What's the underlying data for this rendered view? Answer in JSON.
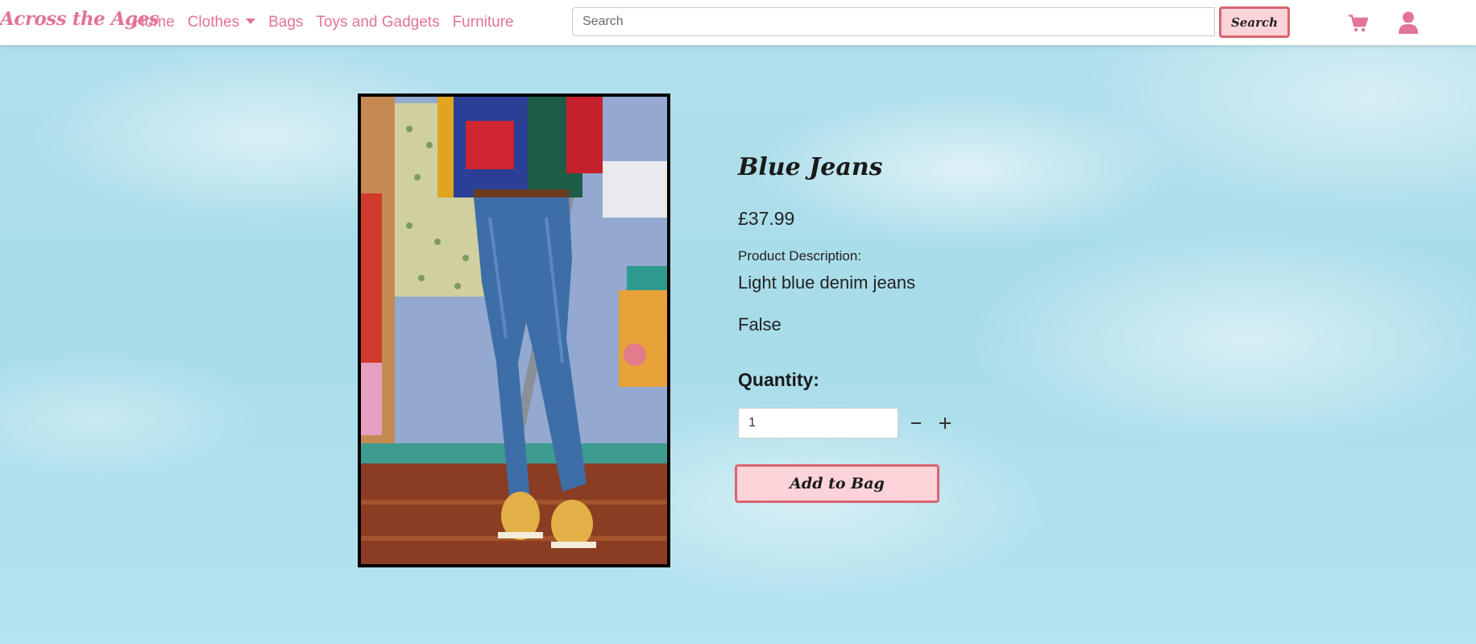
{
  "navbar": {
    "brand": "Across the Ages",
    "links": [
      {
        "label": "Home"
      },
      {
        "label": "Clothes"
      },
      {
        "label": "Bags"
      },
      {
        "label": "Toys and Gadgets"
      },
      {
        "label": "Furniture"
      }
    ],
    "search": {
      "placeholder": "Search",
      "value": "",
      "button_label": "Search"
    },
    "icons": [
      "cart-icon",
      "user-icon"
    ]
  },
  "product": {
    "title": "Blue Jeans",
    "price": "£37.99",
    "description_label": "Product Description:",
    "description": "Light blue denim jeans",
    "flag": "False",
    "quantity_label": "Quantity:",
    "quantity_value": "1",
    "add_button_label": "Add to Bag"
  },
  "colors": {
    "accent_pink": "#e2739a",
    "button_fill": "#fcd3d8",
    "button_border": "#d9646f",
    "sky": "#a8dce9"
  }
}
